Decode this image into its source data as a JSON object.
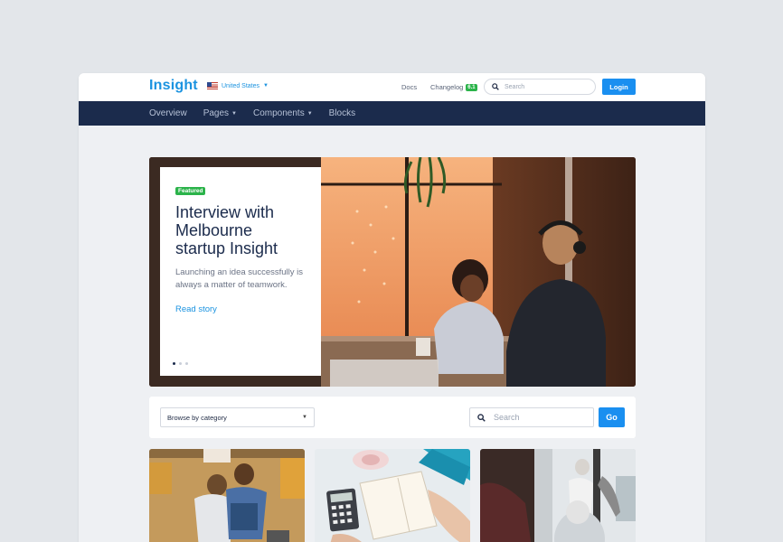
{
  "topbar": {
    "brand": "Insight",
    "country": "United States",
    "docs": "Docs",
    "changelog": "Changelog",
    "changelog_version": "6.1",
    "search_placeholder": "Search",
    "login": "Login"
  },
  "nav": {
    "items": [
      {
        "label": "Overview",
        "caret": false
      },
      {
        "label": "Pages",
        "caret": true
      },
      {
        "label": "Components",
        "caret": true
      },
      {
        "label": "Blocks",
        "caret": false
      }
    ]
  },
  "hero": {
    "badge": "Featured",
    "title": "Interview with Melbourne startup Insight",
    "subtitle": "Launching an idea successfully is always a matter of teamwork.",
    "link": "Read story",
    "slide_count": 3,
    "active_slide": 1
  },
  "filter": {
    "category_selected": "Browse by category",
    "search_placeholder": "Search",
    "go": "Go"
  },
  "colors": {
    "brand": "#1b93e0",
    "navbar": "#1b2b4c",
    "primary_button": "#1a8ff0",
    "badge_green": "#2bb34a"
  },
  "icons": {
    "flag": "us-flag-icon",
    "search": "search-icon",
    "dropdown": "caret-down-icon"
  }
}
